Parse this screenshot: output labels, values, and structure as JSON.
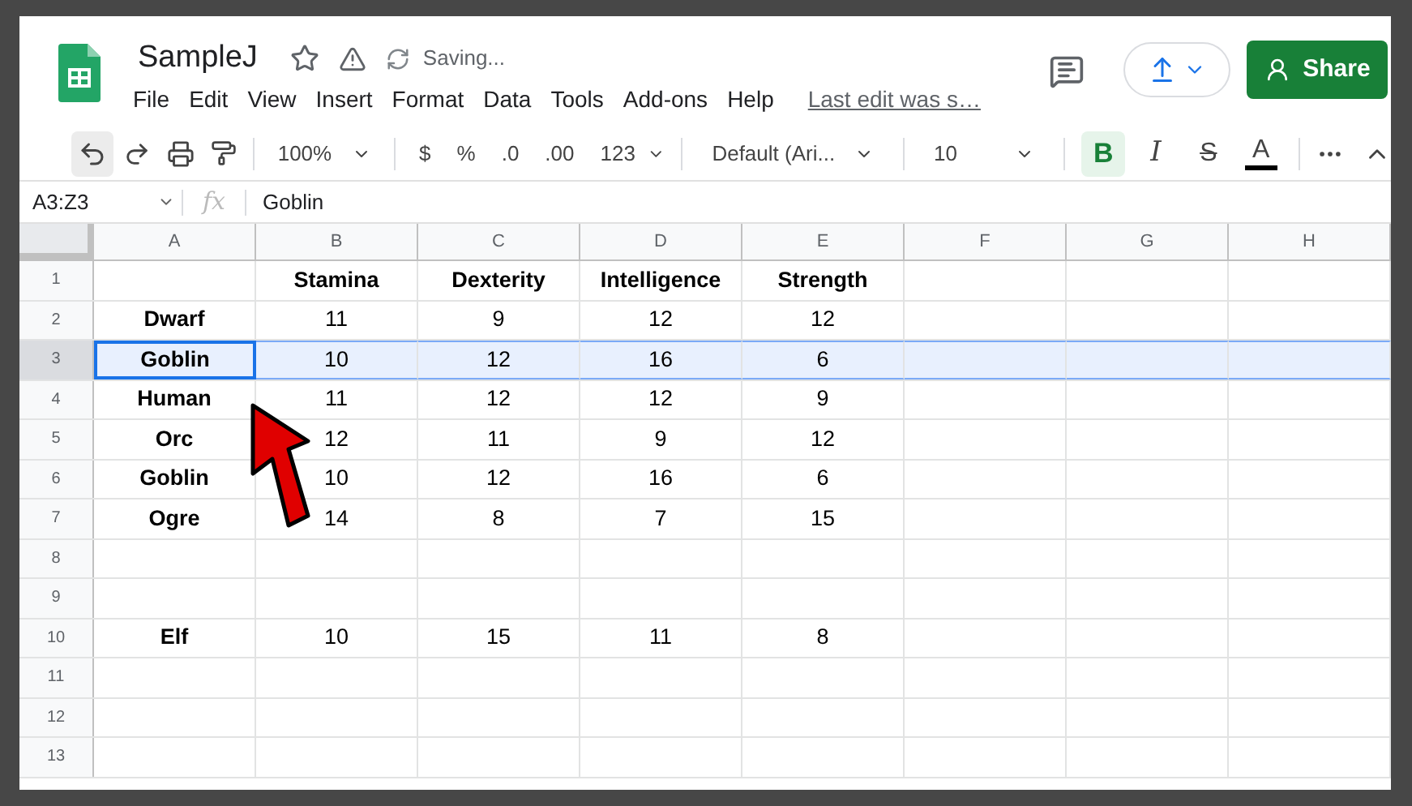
{
  "document": {
    "title": "SampleJ",
    "status": "Saving..."
  },
  "menu": [
    "File",
    "Edit",
    "View",
    "Insert",
    "Format",
    "Data",
    "Tools",
    "Add-ons",
    "Help"
  ],
  "last_edit": "Last edit was s…",
  "share_button": "Share",
  "toolbar": {
    "zoom": "100%",
    "number_formats": [
      "$",
      "%",
      ".0",
      ".00",
      "123"
    ],
    "font": "Default (Ari...",
    "font_size": "10",
    "format_buttons": [
      {
        "kind": "bold",
        "label": "B",
        "selected": true
      },
      {
        "kind": "italic",
        "label": "I",
        "selected": false
      },
      {
        "kind": "strike",
        "label": "S",
        "selected": false
      },
      {
        "kind": "color",
        "label": "A",
        "selected": false
      }
    ]
  },
  "formula_bar": {
    "name_box": "A3:Z3",
    "function_label": "fx",
    "formula": "Goblin"
  },
  "columns": [
    "A",
    "B",
    "C",
    "D",
    "E",
    "F",
    "G",
    "H"
  ],
  "rows": [
    {
      "number": "1",
      "selected": false,
      "cells": [
        "",
        "Stamina",
        "Dexterity",
        "Intelligence",
        "Strength"
      ]
    },
    {
      "number": "2",
      "selected": false,
      "cells": [
        "Dwarf",
        "11",
        "9",
        "12",
        "12"
      ]
    },
    {
      "number": "3",
      "selected": true,
      "cells": [
        "Goblin",
        "10",
        "12",
        "16",
        "6"
      ]
    },
    {
      "number": "4",
      "selected": false,
      "cells": [
        "Human",
        "11",
        "12",
        "12",
        "9"
      ]
    },
    {
      "number": "5",
      "selected": false,
      "cells": [
        "Orc",
        "12",
        "11",
        "9",
        "12"
      ]
    },
    {
      "number": "6",
      "selected": false,
      "cells": [
        "Goblin",
        "10",
        "12",
        "16",
        "6"
      ]
    },
    {
      "number": "7",
      "selected": false,
      "cells": [
        "Ogre",
        "14",
        "8",
        "7",
        "15"
      ]
    },
    {
      "number": "8",
      "selected": false,
      "cells": []
    },
    {
      "number": "9",
      "selected": false,
      "cells": []
    },
    {
      "number": "10",
      "selected": false,
      "cells": [
        "Elf",
        "10",
        "15",
        "11",
        "8"
      ]
    },
    {
      "number": "11",
      "selected": false,
      "cells": []
    },
    {
      "number": "12",
      "selected": false,
      "cells": []
    },
    {
      "number": "13",
      "selected": false,
      "cells": []
    }
  ]
}
